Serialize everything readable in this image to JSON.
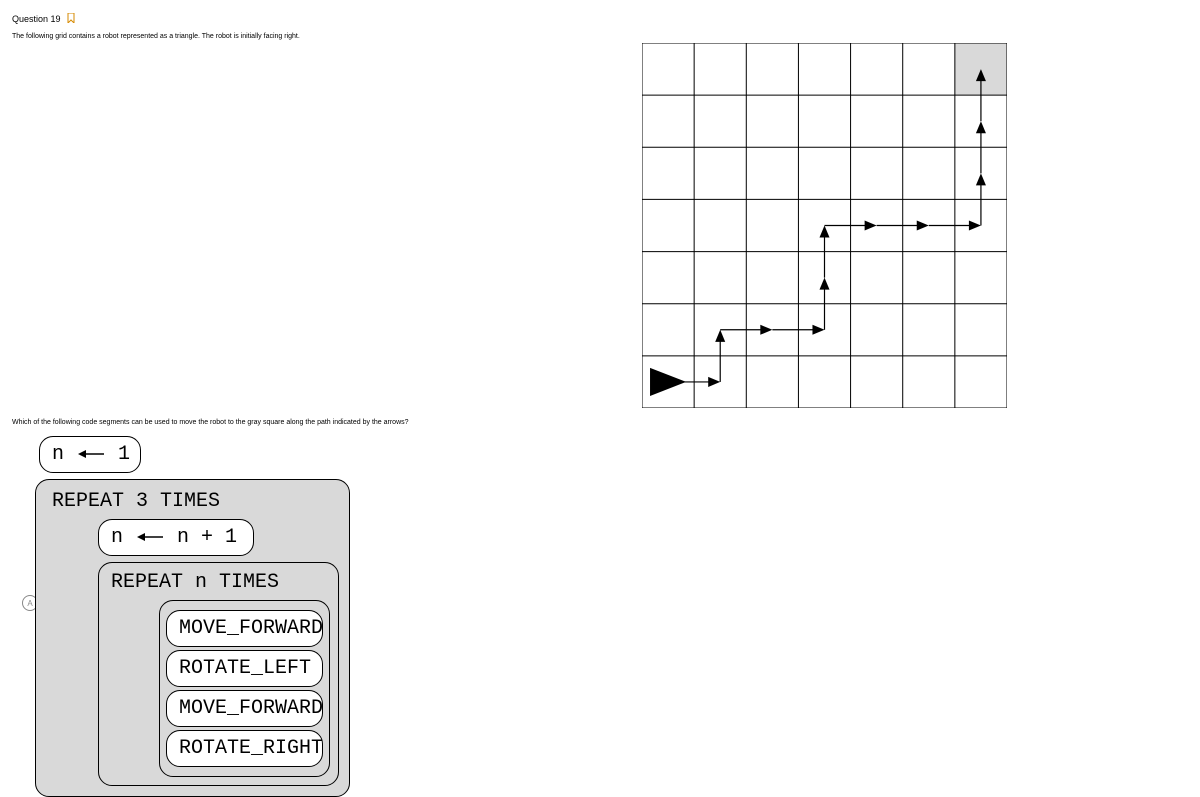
{
  "header": {
    "label": "Question 19"
  },
  "desc1": "The following grid contains a robot represented as a triangle. The robot is initially facing right.",
  "desc2": "Which of the following code segments can be used to move the robot to the gray square along the path indicated by the arrows?",
  "answer_letter": "A",
  "code": {
    "assign_top_lhs": "n",
    "assign_top_rhs": "1",
    "repeat_outer": "REPEAT 3 TIMES",
    "assign_inner_lhs": "n",
    "assign_inner_rhs": "n + 1",
    "repeat_inner": "REPEAT n TIMES",
    "cmd1": "MOVE_FORWARD",
    "cmd2": "ROTATE_LEFT",
    "cmd3": "MOVE_FORWARD",
    "cmd4": "ROTATE_RIGHT"
  },
  "grid": {
    "cols": 7,
    "rows": 7,
    "goal": {
      "col": 6,
      "row": 0
    },
    "robot_start": {
      "col": 0,
      "row": 6,
      "facing": "right"
    },
    "path": [
      {
        "from": [
          0,
          6
        ],
        "to": [
          1,
          6
        ]
      },
      {
        "from": [
          1,
          6
        ],
        "to": [
          1,
          5
        ]
      },
      {
        "from": [
          1,
          5
        ],
        "to": [
          2,
          5
        ]
      },
      {
        "from": [
          2,
          5
        ],
        "to": [
          3,
          5
        ]
      },
      {
        "from": [
          3,
          5
        ],
        "to": [
          3,
          4
        ]
      },
      {
        "from": [
          3,
          4
        ],
        "to": [
          3,
          3
        ]
      },
      {
        "from": [
          3,
          3
        ],
        "to": [
          4,
          3
        ]
      },
      {
        "from": [
          4,
          3
        ],
        "to": [
          5,
          3
        ]
      },
      {
        "from": [
          5,
          3
        ],
        "to": [
          6,
          3
        ]
      },
      {
        "from": [
          6,
          3
        ],
        "to": [
          6,
          2
        ]
      },
      {
        "from": [
          6,
          2
        ],
        "to": [
          6,
          1
        ]
      },
      {
        "from": [
          6,
          1
        ],
        "to": [
          6,
          0
        ]
      }
    ]
  }
}
